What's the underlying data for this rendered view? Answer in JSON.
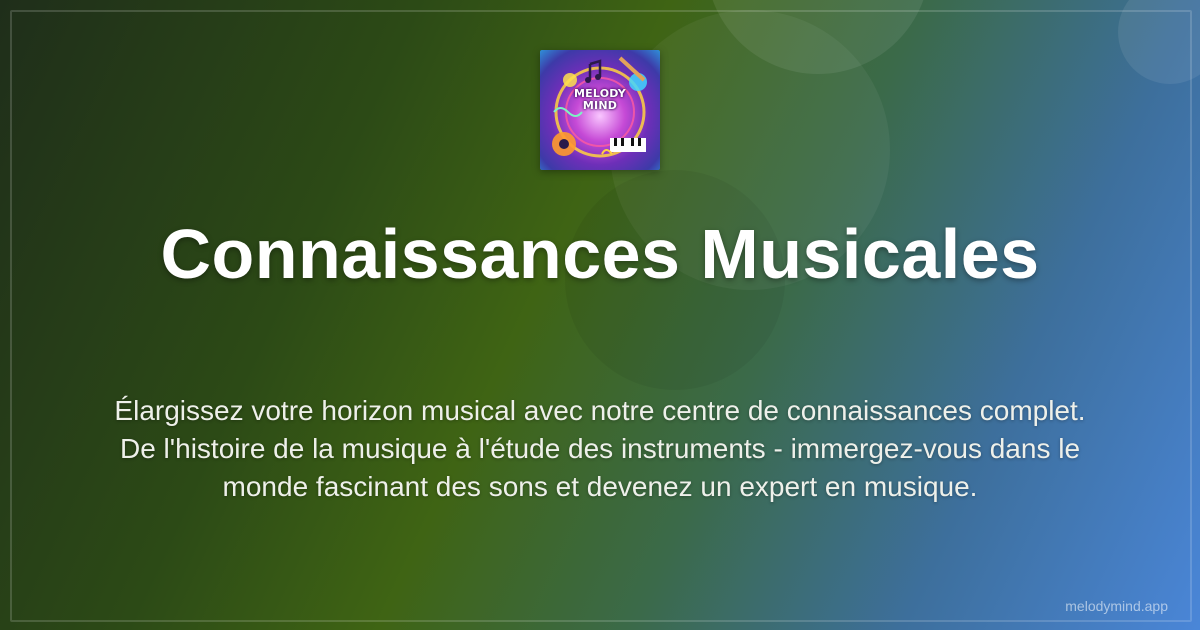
{
  "logo": {
    "wordmark_line1": "MELODY",
    "wordmark_line2": "MIND"
  },
  "title": "Connaissances Musicales",
  "description": "Élargissez votre horizon musical avec notre centre de connaissances complet. De l'histoire de la musique à l'étude des instruments - immergez-vous dans le monde fascinant des sons et devenez un expert en musique.",
  "domain": "melodymind.app",
  "colors": {
    "background_start": "#1f2e1a",
    "background_mid": "#3f6414",
    "background_end": "#4a86d8",
    "text": "#ffffff"
  }
}
